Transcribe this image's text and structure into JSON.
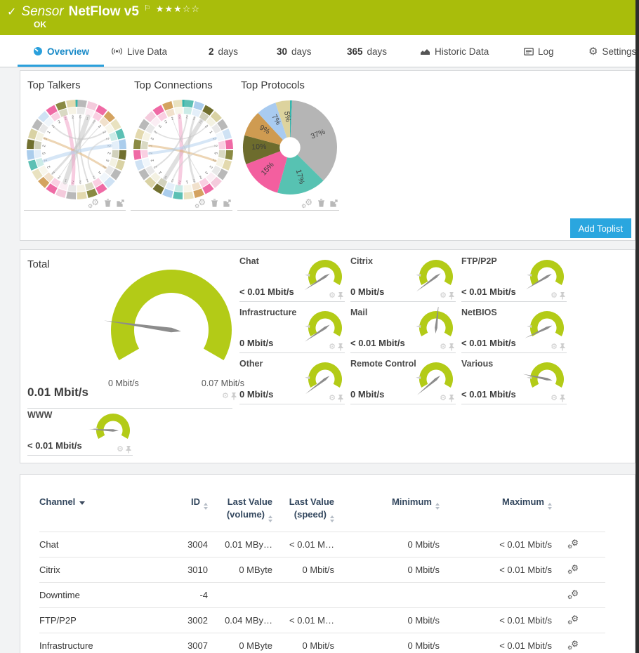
{
  "colors": {
    "header_green": "#a9bd0b",
    "gauge_green": "#b3cb17",
    "accent_blue": "#2aa6df",
    "needle_gray": "#8c8c8c",
    "tab_active_blue": "#1789c7"
  },
  "header": {
    "check": "✓",
    "kind": "Sensor",
    "name": "NetFlow v5",
    "flag": "⚐",
    "stars": "★★★☆☆",
    "status": "OK"
  },
  "tabs": {
    "overview": "Overview",
    "live": "Live Data",
    "d2_num": "2",
    "d2": "days",
    "d30_num": "30",
    "d30": "days",
    "d365_num": "365",
    "d365": "days",
    "historic": "Historic Data",
    "log": "Log",
    "settings": "Settings"
  },
  "toplists": {
    "titles": [
      "Top Talkers",
      "Top Connections",
      "Top Protocols"
    ],
    "add_button": "Add Toplist"
  },
  "chart_data": [
    {
      "type": "chord",
      "title": "Top Talkers",
      "segments": 28,
      "offset": 0,
      "marker_color": "#35b5ac",
      "palette": [
        "#b9b9b9",
        "#f4cbdc",
        "#ef6aa5",
        "#d4a360",
        "#e9e2c0",
        "#5cc0b4",
        "#abcdec",
        "#71702f",
        "#d9d2a4",
        "#b9b9b9",
        "#cfe2f4",
        "#ef6aa5",
        "#8a8a43",
        "#e3d9ae"
      ],
      "digits": [
        "5",
        "1",
        "2",
        "2",
        "2",
        "2",
        "2",
        "2",
        "3",
        "2",
        "2",
        "2",
        "1",
        "2",
        "2",
        "1",
        "2",
        "2",
        "2",
        "2",
        "5",
        "2",
        "2",
        "1",
        "2",
        "2",
        "2",
        "2"
      ],
      "chords": [
        {
          "a": 1,
          "b": 15,
          "c": "#c4c4c4",
          "w": 7
        },
        {
          "a": 2,
          "b": 17,
          "c": "#c4c4c4",
          "w": 3
        },
        {
          "a": 0,
          "b": 12,
          "c": "#c4c4c4",
          "w": 2
        },
        {
          "a": 27,
          "b": 13,
          "c": "#c4c4c4",
          "w": 1.5
        },
        {
          "a": 26,
          "b": 14,
          "c": "#f0a3c6",
          "w": 5
        },
        {
          "a": 9,
          "b": 22,
          "c": "#deb376",
          "w": 3
        },
        {
          "a": 6,
          "b": 19,
          "c": "#b5d2ee",
          "w": 5
        },
        {
          "a": 4,
          "b": 24,
          "c": "#c4c4c4",
          "w": 2
        },
        {
          "a": 3,
          "b": 16,
          "c": "#c4c4c4",
          "w": 1
        },
        {
          "a": 5,
          "b": 11,
          "c": "#cfcfcf",
          "w": 2
        }
      ]
    },
    {
      "type": "chord",
      "title": "Top Connections",
      "segments": 28,
      "offset": 5,
      "marker_color": "#35b5ac",
      "palette": [
        "#b9b9b9",
        "#f4cbdc",
        "#ef6aa5",
        "#d4a360",
        "#e9e2c0",
        "#5cc0b4",
        "#abcdec",
        "#71702f",
        "#d9d2a4",
        "#b9b9b9",
        "#cfe2f4",
        "#ef6aa5",
        "#8a8a43",
        "#e3d9ae"
      ],
      "digits": [
        "2",
        "2",
        "2",
        "2",
        "1",
        "2",
        "2",
        "5",
        "2",
        "2",
        "2",
        "2",
        "2",
        "1",
        "2",
        "2",
        "3",
        "2",
        "2",
        "2",
        "2",
        "1",
        "2",
        "2",
        "5",
        "2",
        "2",
        "2"
      ],
      "chords": [
        {
          "a": 2,
          "b": 16,
          "c": "#c4c4c4",
          "w": 6
        },
        {
          "a": 1,
          "b": 12,
          "c": "#c4c4c4",
          "w": 3
        },
        {
          "a": 27,
          "b": 14,
          "c": "#f0a3c6",
          "w": 5
        },
        {
          "a": 0,
          "b": 18,
          "c": "#c4c4c4",
          "w": 2
        },
        {
          "a": 8,
          "b": 21,
          "c": "#deb376",
          "w": 3
        },
        {
          "a": 5,
          "b": 20,
          "c": "#b5d2ee",
          "w": 4
        },
        {
          "a": 3,
          "b": 23,
          "c": "#c4c4c4",
          "w": 1.5
        },
        {
          "a": 6,
          "b": 15,
          "c": "#cfcfcf",
          "w": 2
        },
        {
          "a": 26,
          "b": 11,
          "c": "#c4c4c4",
          "w": 1
        }
      ]
    },
    {
      "type": "pie",
      "title": "Top Protocols",
      "hole_ratio": 0.22,
      "slices": [
        {
          "label": "",
          "value": 0.7,
          "color": "#35b5ac"
        },
        {
          "label": "37%",
          "value": 37,
          "color": "#b5b5b5"
        },
        {
          "label": "17%",
          "value": 17,
          "color": "#57c2b2"
        },
        {
          "label": "15%",
          "value": 15,
          "color": "#f35f9f"
        },
        {
          "label": "10%",
          "value": 10,
          "color": "#6d6c2d"
        },
        {
          "label": "9%",
          "value": 9,
          "color": "#cf9b51"
        },
        {
          "label": "7%",
          "value": 7,
          "color": "#a9cbf0"
        },
        {
          "label": "5%",
          "value": 5,
          "color": "#ddd39e"
        }
      ]
    }
  ],
  "gauges": {
    "total": {
      "title": "Total",
      "value": "0.01 Mbit/s",
      "min_label": "0 Mbit/s",
      "max_label": "0.07 Mbit/s",
      "needle_deg": 172
    },
    "small": [
      {
        "title": "Chat",
        "value": "< 0.01 Mbit/s",
        "needle_deg": 213
      },
      {
        "title": "Citrix",
        "value": "0 Mbit/s",
        "needle_deg": 217
      },
      {
        "title": "FTP/P2P",
        "value": "< 0.01 Mbit/s",
        "needle_deg": 211
      },
      {
        "title": "Infrastructure",
        "value": "0 Mbit/s",
        "needle_deg": 214
      },
      {
        "title": "Mail",
        "value": "< 0.01 Mbit/s",
        "needle_deg": 84
      },
      {
        "title": "NetBIOS",
        "value": "< 0.01 Mbit/s",
        "needle_deg": 205
      },
      {
        "title": "Other",
        "value": "0 Mbit/s",
        "needle_deg": 217
      },
      {
        "title": "Remote Control",
        "value": "0 Mbit/s",
        "needle_deg": 220
      },
      {
        "title": "Various",
        "value": "< 0.01 Mbit/s",
        "needle_deg": 168
      }
    ],
    "www": {
      "title": "WWW",
      "value": "< 0.01 Mbit/s",
      "needle_deg": 177
    }
  },
  "table": {
    "headers": {
      "channel": "Channel",
      "id": "ID",
      "vol1": "Last Value",
      "vol2": "(volume)",
      "speed1": "Last Value",
      "speed2": "(speed)",
      "min": "Minimum",
      "max": "Maximum"
    },
    "rows": [
      {
        "channel": "Chat",
        "id": "3004",
        "vol": "0.01 MBy…",
        "speed": "< 0.01 M…",
        "min": "0 Mbit/s",
        "max": "< 0.01 Mbit/s"
      },
      {
        "channel": "Citrix",
        "id": "3010",
        "vol": "0 MByte",
        "speed": "0 Mbit/s",
        "min": "0 Mbit/s",
        "max": "< 0.01 Mbit/s"
      },
      {
        "channel": "Downtime",
        "id": "-4",
        "vol": "",
        "speed": "",
        "min": "",
        "max": ""
      },
      {
        "channel": "FTP/P2P",
        "id": "3002",
        "vol": "0.04 MBy…",
        "speed": "< 0.01 M…",
        "min": "0 Mbit/s",
        "max": "< 0.01 Mbit/s"
      },
      {
        "channel": "Infrastructure",
        "id": "3007",
        "vol": "0 MByte",
        "speed": "0 Mbit/s",
        "min": "0 Mbit/s",
        "max": "< 0.01 Mbit/s"
      }
    ]
  }
}
